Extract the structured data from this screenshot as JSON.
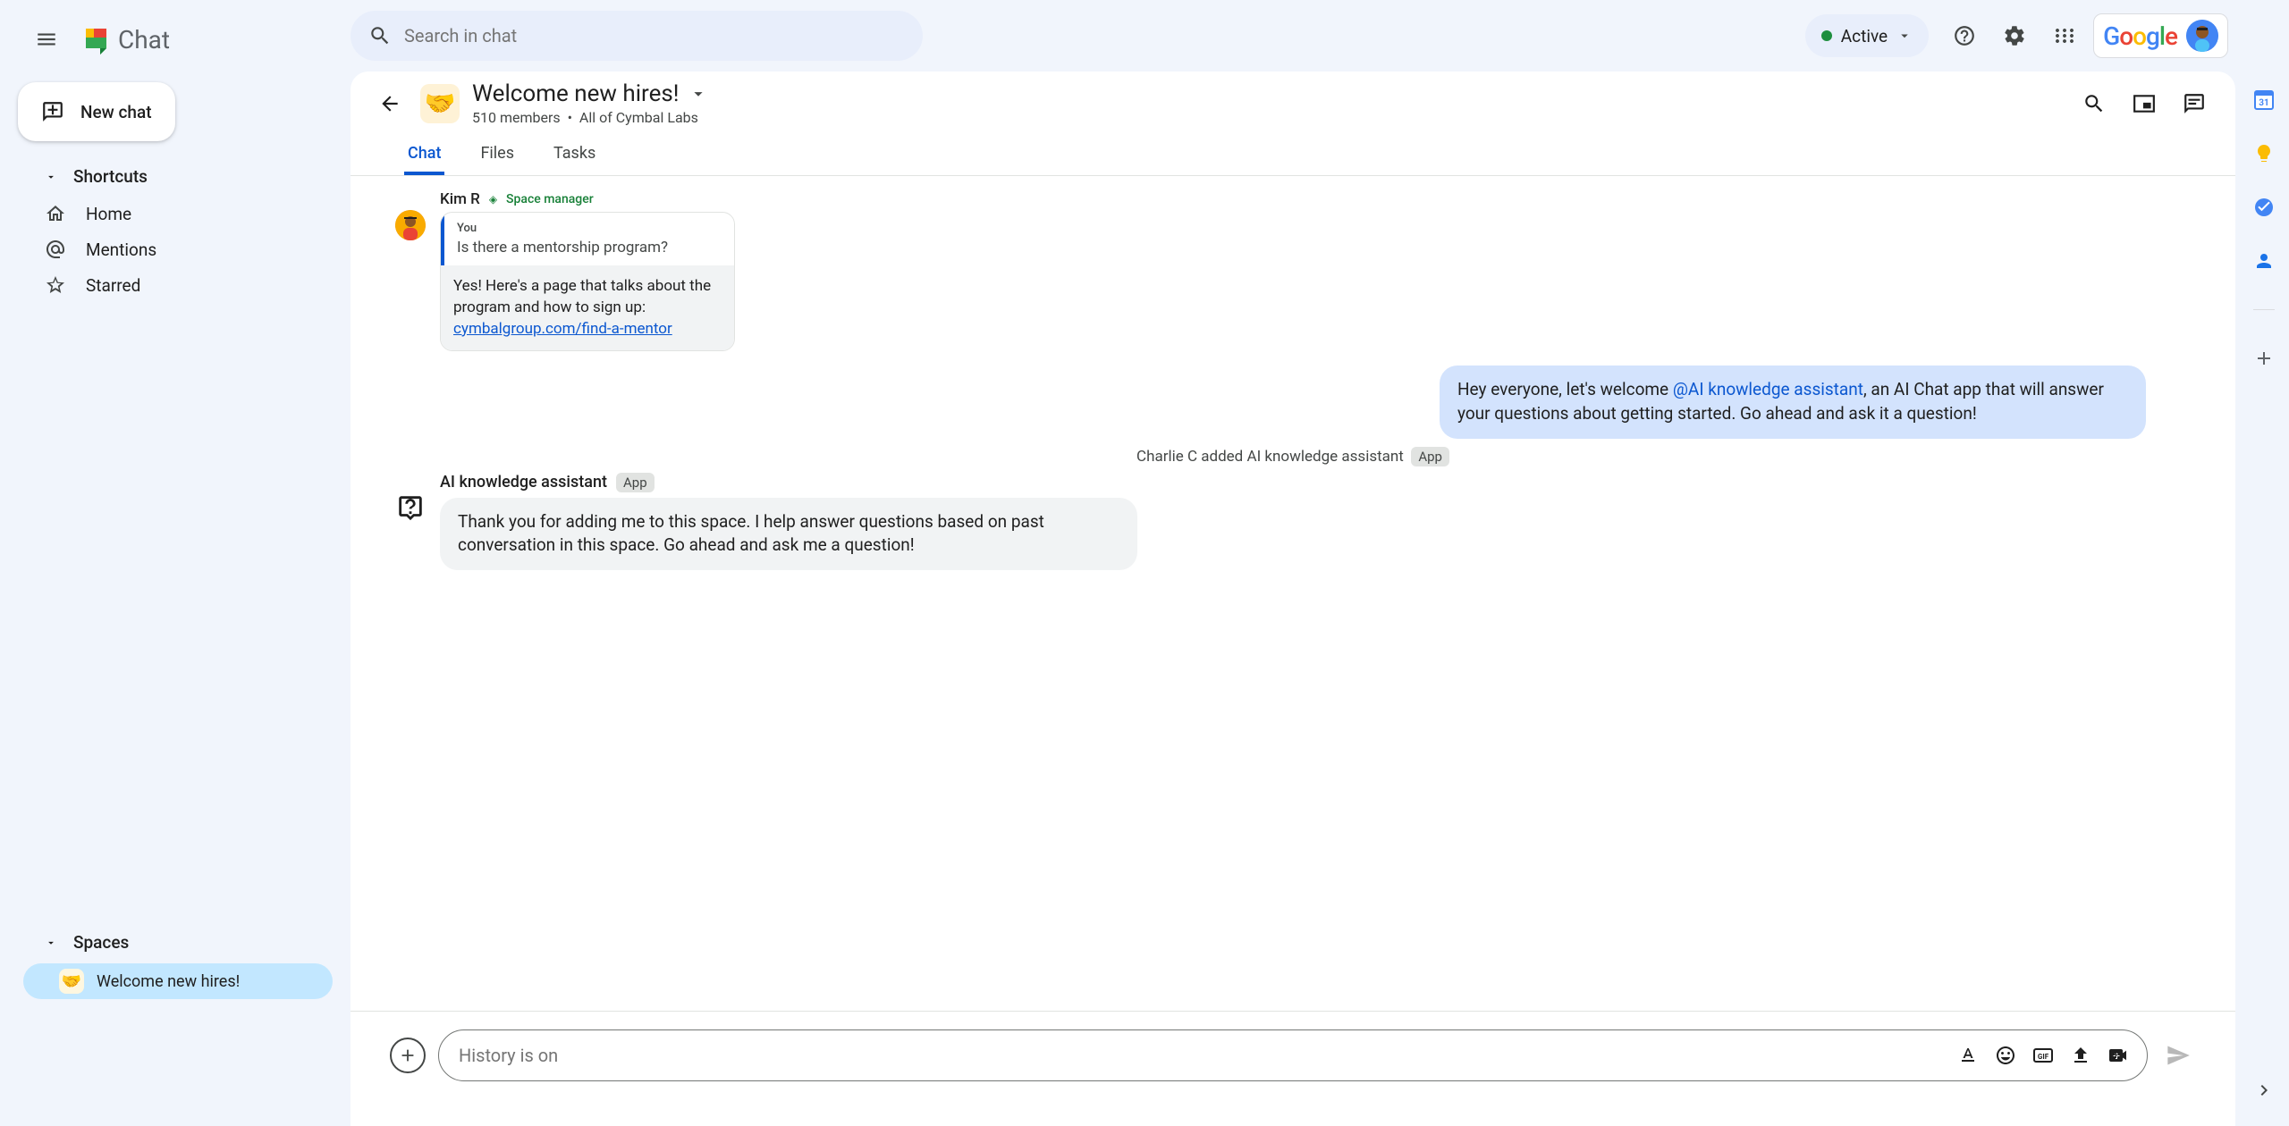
{
  "app": {
    "name": "Chat"
  },
  "search": {
    "placeholder": "Search in chat"
  },
  "status": {
    "label": "Active"
  },
  "newChat": {
    "label": "New chat"
  },
  "sidebar": {
    "shortcuts": {
      "header": "Shortcuts"
    },
    "items": [
      {
        "icon": "home",
        "label": "Home"
      },
      {
        "icon": "mentions",
        "label": "Mentions"
      },
      {
        "icon": "starred",
        "label": "Starred"
      }
    ],
    "spaces": {
      "header": "Spaces"
    },
    "spaceItems": [
      {
        "emoji": "🤝",
        "label": "Welcome new hires!",
        "active": true
      }
    ]
  },
  "space": {
    "emoji": "🤝",
    "title": "Welcome new hires!",
    "membersText": "510 members",
    "orgText": "All of Cymbal Labs",
    "tabs": [
      {
        "label": "Chat",
        "active": true
      },
      {
        "label": "Files",
        "active": false
      },
      {
        "label": "Tasks",
        "active": false
      }
    ]
  },
  "messages": {
    "kim": {
      "name": "Kim R",
      "role": "Space manager",
      "quoteAuthor": "You",
      "quoteText": "Is there a mentorship program?",
      "replyIntro": "Yes! Here's a page that talks about the program and how to sign up: ",
      "replyLink": "cymbalgroup.com/find-a-mentor"
    },
    "hey": {
      "part1": "Hey everyone, let's welcome ",
      "mention": "@AI knowledge assistant",
      "part2": ", an AI Chat app that will answer your questions about getting started.  Go ahead and ask it a question!"
    },
    "sysEvent": {
      "text": "Charlie C added AI knowledge assistant",
      "badge": "App"
    },
    "ai": {
      "name": "AI knowledge assistant",
      "badge": "App",
      "text": "Thank you for adding me to this space. I help answer questions based on past conversation in this space. Go ahead and ask me a question!"
    }
  },
  "composer": {
    "placeholder": "History is on"
  },
  "google": {
    "logo": "Google"
  }
}
